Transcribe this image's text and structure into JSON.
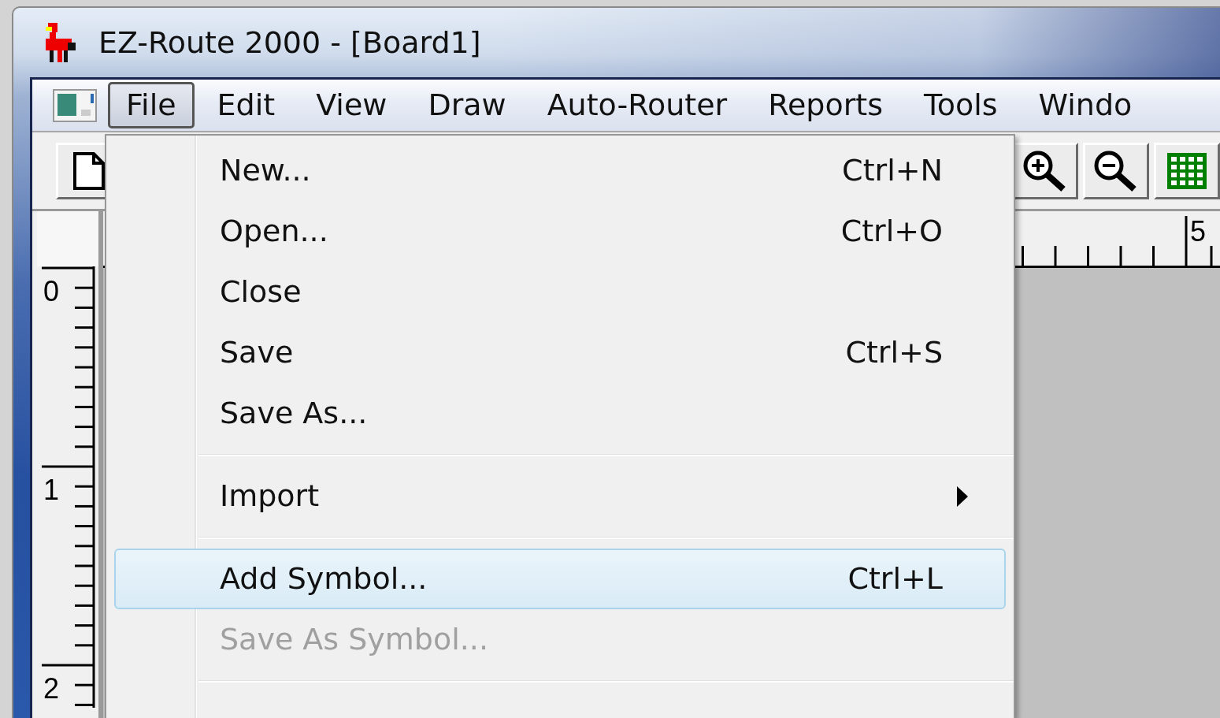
{
  "window": {
    "title": "EZ-Route 2000 - [Board1]"
  },
  "menu_bar": [
    {
      "label": "File",
      "selected": true
    },
    {
      "label": "Edit",
      "selected": false
    },
    {
      "label": "View",
      "selected": false
    },
    {
      "label": "Draw",
      "selected": false
    },
    {
      "label": "Auto-Router",
      "selected": false
    },
    {
      "label": "Reports",
      "selected": false
    },
    {
      "label": "Tools",
      "selected": false
    },
    {
      "label": "Windo",
      "selected": false
    }
  ],
  "file_menu": [
    {
      "kind": "item",
      "label": "New...",
      "shortcut": "Ctrl+N",
      "selected": false,
      "disabled": false
    },
    {
      "kind": "item",
      "label": "Open...",
      "shortcut": "Ctrl+O",
      "selected": false,
      "disabled": false
    },
    {
      "kind": "item",
      "label": "Close",
      "selected": false,
      "disabled": false
    },
    {
      "kind": "item",
      "label": "Save",
      "shortcut": "Ctrl+S",
      "selected": false,
      "disabled": false
    },
    {
      "kind": "item",
      "label": "Save As...",
      "selected": false,
      "disabled": false
    },
    {
      "kind": "separator"
    },
    {
      "kind": "submenu",
      "label": "Import",
      "selected": false,
      "disabled": false
    },
    {
      "kind": "separator"
    },
    {
      "kind": "item",
      "label": "Add Symbol...",
      "shortcut": "Ctrl+L",
      "selected": true,
      "disabled": false
    },
    {
      "kind": "item",
      "label": "Save As Symbol...",
      "selected": false,
      "disabled": true
    },
    {
      "kind": "separator"
    }
  ],
  "horizontal_ruler": {
    "labels": [
      "5"
    ]
  },
  "vertical_ruler": {
    "labels": [
      "0",
      "1",
      "2"
    ]
  }
}
